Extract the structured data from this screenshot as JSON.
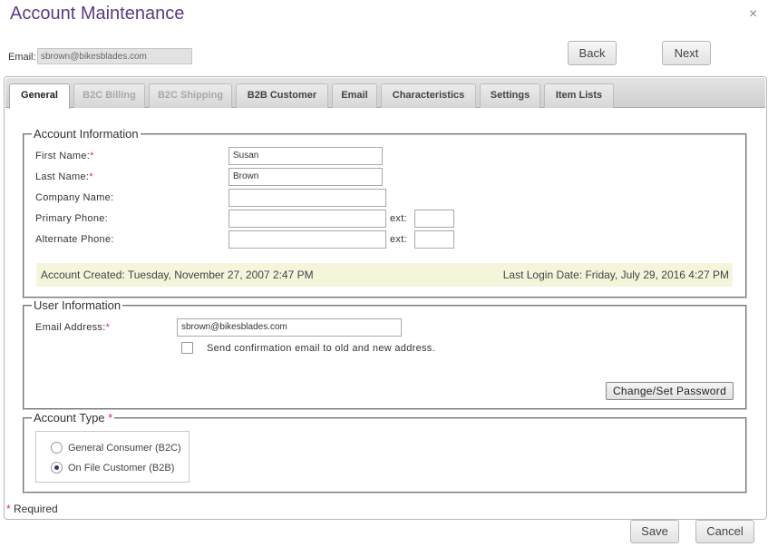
{
  "dialog": {
    "title": "Account Maintenance",
    "close_glyph": "×"
  },
  "header": {
    "email_label": "Email:",
    "email_value": "sbrown@bikesblades.com"
  },
  "nav": {
    "back_label": "Back",
    "next_label": "Next"
  },
  "tabs": [
    {
      "label": "General",
      "state": "active"
    },
    {
      "label": "B2C Billing",
      "state": "disabled"
    },
    {
      "label": "B2C Shipping",
      "state": "disabled"
    },
    {
      "label": "B2B Customer",
      "state": "enabled"
    },
    {
      "label": "Email",
      "state": "enabled"
    },
    {
      "label": "Characteristics",
      "state": "enabled"
    },
    {
      "label": "Settings",
      "state": "enabled"
    },
    {
      "label": "Item Lists",
      "state": "enabled"
    }
  ],
  "account_info": {
    "legend": "Account Information",
    "first_name_label": "First Name:",
    "first_name_value": "Susan",
    "last_name_label": "Last Name:",
    "last_name_value": "Brown",
    "company_label": "Company Name:",
    "company_value": "",
    "primary_phone_label": "Primary Phone:",
    "primary_phone_value": "",
    "alternate_phone_label": "Alternate Phone:",
    "alternate_phone_value": "",
    "ext_label": "ext:",
    "required_marker": "*",
    "created_text": "Account Created: Tuesday, November 27, 2007 2:47 PM",
    "last_login_text": "Last Login Date: Friday, July 29, 2016 4:27 PM"
  },
  "user_info": {
    "legend": "User Information",
    "email_label": "Email Address:",
    "email_value": "sbrown@bikesblades.com",
    "confirm_label": "Send confirmation email to old and new address.",
    "confirm_checked": false,
    "change_password_label": "Change/Set Password"
  },
  "account_type": {
    "legend": "Account Type",
    "options": [
      {
        "label": "General Consumer (B2C)",
        "checked": false
      },
      {
        "label": "On File Customer (B2B)",
        "checked": true
      }
    ]
  },
  "footer": {
    "required_note": "Required",
    "save_label": "Save",
    "cancel_label": "Cancel"
  },
  "colors": {
    "title": "#5c3c82",
    "required": "#d33333",
    "info_bar": "#f5f5dc"
  }
}
